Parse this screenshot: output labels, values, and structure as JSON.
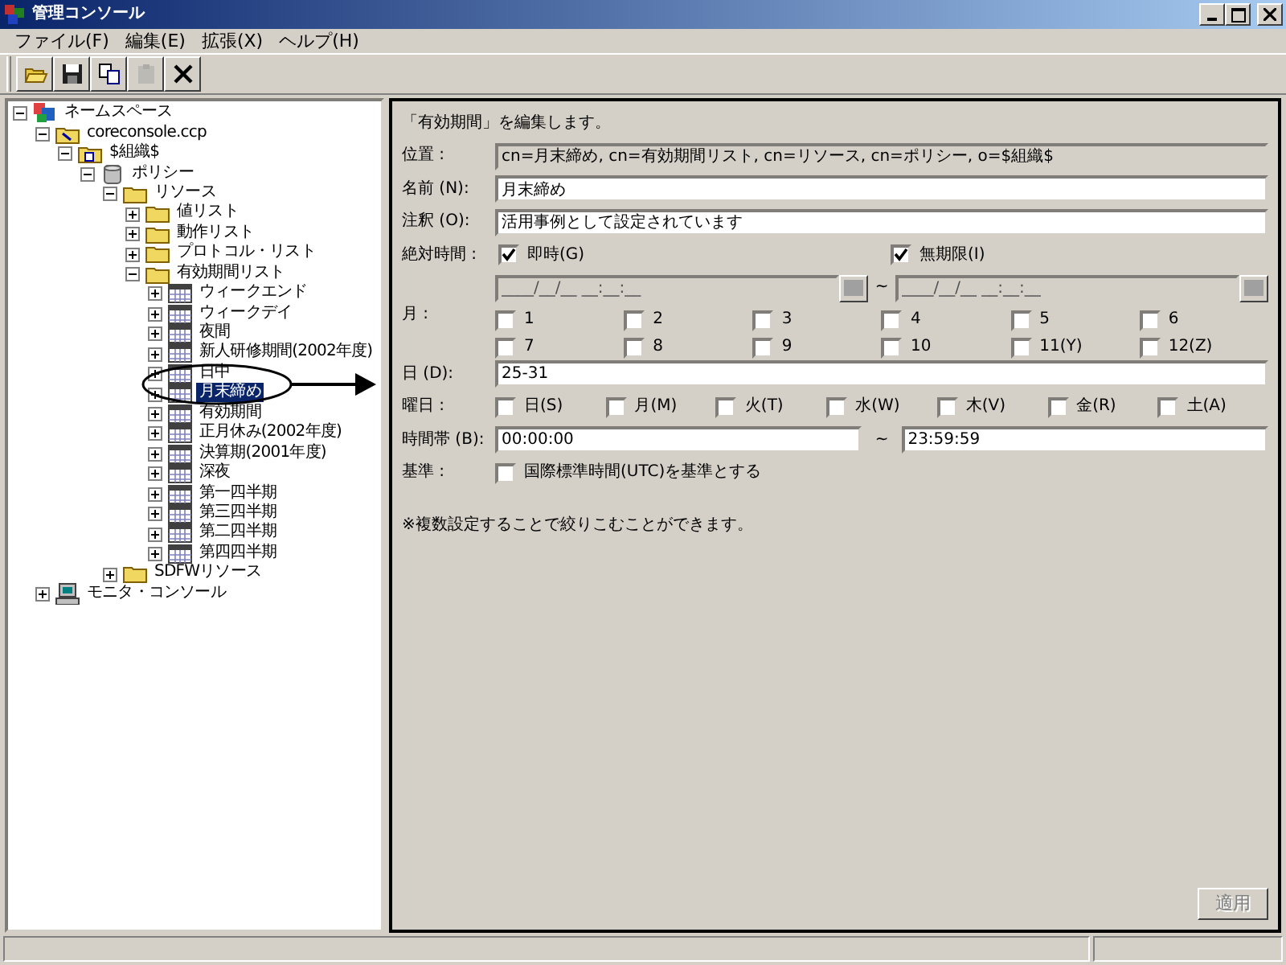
{
  "window": {
    "title": "管理コンソール"
  },
  "menu": [
    "ファイル(F)",
    "編集(E)",
    "拡張(X)",
    "ヘルプ(H)"
  ],
  "toolbar": [
    {
      "kind": "open",
      "disabled": false
    },
    {
      "kind": "save",
      "disabled": false
    },
    {
      "kind": "copy",
      "disabled": false
    },
    {
      "kind": "paste",
      "disabled": true
    },
    {
      "kind": "delete",
      "disabled": false
    }
  ],
  "tree": [
    {
      "label": "ネームスペース",
      "kind": "namespace",
      "expanded": true,
      "selected": false,
      "children": [
        {
          "label": "coreconsole.ccp",
          "kind": "file",
          "expanded": true,
          "selected": false,
          "children": [
            {
              "label": "$組織$",
              "kind": "org",
              "expanded": true,
              "selected": false,
              "children": [
                {
                  "label": "ポリシー",
                  "kind": "policy",
                  "expanded": true,
                  "selected": false,
                  "children": [
                    {
                      "label": "リソース",
                      "kind": "folder",
                      "expanded": true,
                      "selected": false,
                      "children": [
                        {
                          "label": "値リスト",
                          "kind": "folder",
                          "expanded": false,
                          "selected": false
                        },
                        {
                          "label": "動作リスト",
                          "kind": "folder",
                          "expanded": false,
                          "selected": false
                        },
                        {
                          "label": "プロトコル・リスト",
                          "kind": "folder",
                          "expanded": false,
                          "selected": false
                        },
                        {
                          "label": "有効期間リスト",
                          "kind": "folder",
                          "expanded": true,
                          "selected": false,
                          "children": [
                            {
                              "label": "ウィークエンド",
                              "kind": "calendar",
                              "expanded": false,
                              "selected": false
                            },
                            {
                              "label": "ウィークデイ",
                              "kind": "calendar",
                              "expanded": false,
                              "selected": false
                            },
                            {
                              "label": "夜間",
                              "kind": "calendar",
                              "expanded": false,
                              "selected": false
                            },
                            {
                              "label": "新人研修期間(2002年度)",
                              "kind": "calendar",
                              "expanded": false,
                              "selected": false
                            },
                            {
                              "label": "日中",
                              "kind": "calendar",
                              "expanded": false,
                              "selected": false
                            },
                            {
                              "label": "月末締め",
                              "kind": "calendar",
                              "expanded": false,
                              "selected": true
                            },
                            {
                              "label": "有効期間",
                              "kind": "calendar",
                              "expanded": false,
                              "selected": false
                            },
                            {
                              "label": "正月休み(2002年度)",
                              "kind": "calendar",
                              "expanded": false,
                              "selected": false
                            },
                            {
                              "label": "決算期(2001年度)",
                              "kind": "calendar",
                              "expanded": false,
                              "selected": false
                            },
                            {
                              "label": "深夜",
                              "kind": "calendar",
                              "expanded": false,
                              "selected": false
                            },
                            {
                              "label": "第一四半期",
                              "kind": "calendar",
                              "expanded": false,
                              "selected": false
                            },
                            {
                              "label": "第三四半期",
                              "kind": "calendar",
                              "expanded": false,
                              "selected": false
                            },
                            {
                              "label": "第二四半期",
                              "kind": "calendar",
                              "expanded": false,
                              "selected": false
                            },
                            {
                              "label": "第四四半期",
                              "kind": "calendar",
                              "expanded": false,
                              "selected": false
                            }
                          ]
                        }
                      ]
                    },
                    {
                      "label": "SDFWリソース",
                      "kind": "folder",
                      "expanded": false,
                      "selected": false
                    }
                  ]
                }
              ]
            }
          ]
        },
        {
          "label": "モニタ・コンソール",
          "kind": "monitor",
          "expanded": false,
          "selected": false
        }
      ]
    }
  ],
  "panel": {
    "heading": "「有効期間」を編集します。",
    "location": {
      "label": "位置 :",
      "value": "cn=月末締め, cn=有効期間リスト, cn=リソース, cn=ポリシー, o=$組織$"
    },
    "name": {
      "label": "名前 (N):",
      "value": "月末締め"
    },
    "note": {
      "label": "注釈 (O):",
      "value": "活用事例として設定されています"
    },
    "absolute": {
      "label": "絶対時間 :",
      "separator": "~",
      "start": {
        "label": "即時(G)",
        "checked": true,
        "value": "____/__/__ __:__:__"
      },
      "end": {
        "label": "無期限(I)",
        "checked": true,
        "value": "____/__/__ __:__:__"
      }
    },
    "months": {
      "label": "月 :",
      "items": [
        {
          "label": "1",
          "checked": false
        },
        {
          "label": "2",
          "checked": false
        },
        {
          "label": "3",
          "checked": false
        },
        {
          "label": "4",
          "checked": false
        },
        {
          "label": "5",
          "checked": false
        },
        {
          "label": "6",
          "checked": false
        },
        {
          "label": "7",
          "checked": false
        },
        {
          "label": "8",
          "checked": false
        },
        {
          "label": "9",
          "checked": false
        },
        {
          "label": "10",
          "checked": false
        },
        {
          "label": "11(Y)",
          "checked": false
        },
        {
          "label": "12(Z)",
          "checked": false
        }
      ]
    },
    "day": {
      "label": "日 (D):",
      "value": "25-31"
    },
    "weekdays": {
      "label": "曜日 :",
      "items": [
        {
          "label": "日(S)",
          "checked": false
        },
        {
          "label": "月(M)",
          "checked": false
        },
        {
          "label": "火(T)",
          "checked": false
        },
        {
          "label": "水(W)",
          "checked": false
        },
        {
          "label": "木(V)",
          "checked": false
        },
        {
          "label": "金(R)",
          "checked": false
        },
        {
          "label": "土(A)",
          "checked": false
        }
      ]
    },
    "time": {
      "label": "時間帯 (B):",
      "from": "00:00:00",
      "separator": "~",
      "to": "23:59:59"
    },
    "basis": {
      "label": "基準 :",
      "option": {
        "label": "国際標準時間(UTC)を基準とする",
        "checked": false
      }
    },
    "hint": "※複数設定することで絞りこむことができます。",
    "apply": {
      "label": "適用",
      "disabled": true
    }
  }
}
